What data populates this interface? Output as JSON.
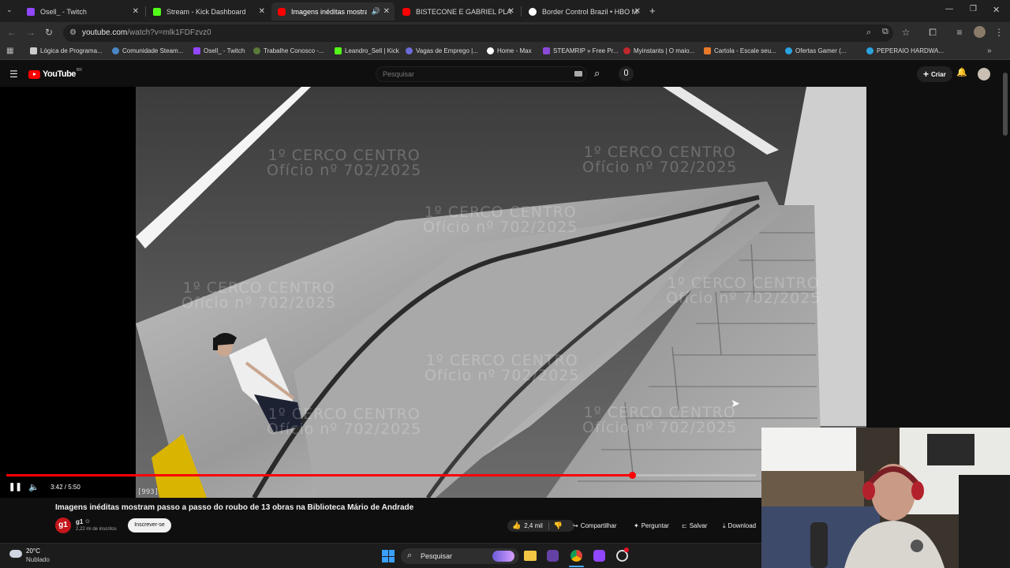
{
  "browser": {
    "tabs": [
      {
        "label": "Osell_ - Twitch",
        "active": false
      },
      {
        "label": "Stream - Kick Dashboard",
        "active": false
      },
      {
        "label": "Imagens inéditas mostram",
        "active": true
      },
      {
        "label": "BISTECONE E GABRIEL PLANEJA",
        "active": false
      },
      {
        "label": "Border Control Brazil • HBO Ma",
        "active": false
      }
    ],
    "url_host": "youtube.com",
    "url_path": "/watch?v=mlk1FDFzvz0",
    "bookmarks": [
      "Lógica de Programa...",
      "Comunidade Steam...",
      "Osell_ - Twitch",
      "Trabalhe Conosco -...",
      "Leandro_Sell | Kick",
      "Vagas de Emprego |...",
      "Home - Max",
      "STEAMRIP » Free Pr...",
      "Myinstants | O maio...",
      "Cartola - Escale seu...",
      "Ofertas Gamer (...",
      "PEPERAIO HARDWA..."
    ]
  },
  "youtube": {
    "logo_text": "YouTube",
    "logo_region": "BR",
    "search_placeholder": "Pesquisar",
    "create_label": "Criar"
  },
  "video": {
    "watermark_line1": "1º CERCO CENTRO",
    "watermark_line2": "Ofício nº 702/2025",
    "frame_counter": "[993]",
    "time_current": "3:42",
    "time_total": "5:50",
    "progress": 0.835,
    "title": "Imagens inéditas mostram passo a passo do roubo de 13 obras na Biblioteca Mário de Andrade"
  },
  "channel": {
    "name": "g1",
    "subscribers": "2,22 mi de inscritos",
    "subscribe_label": "Inscrever-se"
  },
  "actions": {
    "likes": "2,4 mil",
    "share": "Compartilhar",
    "ask": "Perguntar",
    "save": "Salvar",
    "download": "Download"
  },
  "taskbar": {
    "weather_temp": "20°C",
    "weather_desc": "Nublado",
    "search_label": "Pesquisar"
  },
  "colors": {
    "accent_red": "#ff0000",
    "kick_green": "#53fc18",
    "twitch_purple": "#9146ff"
  }
}
